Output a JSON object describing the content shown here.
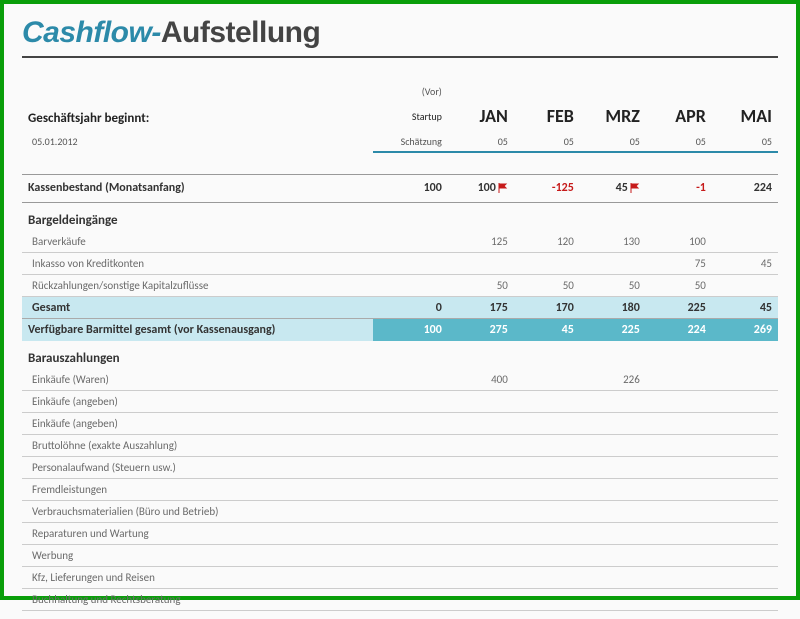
{
  "title": {
    "part1": "Cashflow-",
    "part2": "Aufstellung"
  },
  "fy_label": "Geschäftsjahr beginnt:",
  "fy_date": "05.01.2012",
  "pre_header": {
    "line1": "(Vor)",
    "line2": "Startup",
    "line3": "Schätzung"
  },
  "months": [
    "JAN",
    "FEB",
    "MRZ",
    "APR",
    "MAI"
  ],
  "year_suffix": [
    "05",
    "05",
    "05",
    "05",
    "05"
  ],
  "kassenbestand": {
    "label": "Kassenbestand (Monatsanfang)",
    "start": "100",
    "vals": [
      "100",
      "-125",
      "45",
      "-1",
      "224"
    ],
    "flags": [
      true,
      false,
      true,
      false,
      false
    ]
  },
  "eingaenge": {
    "title": "Bargeldeingänge",
    "rows": [
      {
        "label": "Barverkäufe",
        "start": "",
        "vals": [
          "125",
          "120",
          "130",
          "100",
          ""
        ]
      },
      {
        "label": "Inkasso von Kreditkonten",
        "start": "",
        "vals": [
          "",
          "",
          "",
          "75",
          "45"
        ]
      },
      {
        "label": "Rückzahlungen/sonstige Kapitalzuflüsse",
        "start": "",
        "vals": [
          "50",
          "50",
          "50",
          "50",
          ""
        ]
      }
    ],
    "gesamt": {
      "label": "Gesamt",
      "start": "0",
      "vals": [
        "175",
        "170",
        "180",
        "225",
        "45"
      ]
    },
    "verfuegbar": {
      "label": "Verfügbare Barmittel gesamt (vor Kassenausgang)",
      "start": "100",
      "vals": [
        "275",
        "45",
        "225",
        "224",
        "269"
      ]
    }
  },
  "auszahlungen": {
    "title": "Barauszahlungen",
    "rows": [
      {
        "label": "Einkäufe (Waren)",
        "start": "",
        "vals": [
          "400",
          "",
          "226",
          "",
          ""
        ]
      },
      {
        "label": "Einkäufe (angeben)",
        "start": "",
        "vals": [
          "",
          "",
          "",
          "",
          ""
        ]
      },
      {
        "label": "Einkäufe (angeben)",
        "start": "",
        "vals": [
          "",
          "",
          "",
          "",
          ""
        ]
      },
      {
        "label": "Bruttolöhne (exakte Auszahlung)",
        "start": "",
        "vals": [
          "",
          "",
          "",
          "",
          ""
        ]
      },
      {
        "label": "Personalaufwand (Steuern usw.)",
        "start": "",
        "vals": [
          "",
          "",
          "",
          "",
          ""
        ]
      },
      {
        "label": "Fremdleistungen",
        "start": "",
        "vals": [
          "",
          "",
          "",
          "",
          ""
        ]
      },
      {
        "label": "Verbrauchsmaterialien (Büro und Betrieb)",
        "start": "",
        "vals": [
          "",
          "",
          "",
          "",
          ""
        ]
      },
      {
        "label": "Reparaturen und Wartung",
        "start": "",
        "vals": [
          "",
          "",
          "",
          "",
          ""
        ]
      },
      {
        "label": "Werbung",
        "start": "",
        "vals": [
          "",
          "",
          "",
          "",
          ""
        ]
      },
      {
        "label": "Kfz, Lieferungen und Reisen",
        "start": "",
        "vals": [
          "",
          "",
          "",
          "",
          ""
        ]
      },
      {
        "label": "Buchhaltung und Rechtsberatung",
        "start": "",
        "vals": [
          "",
          "",
          "",
          "",
          ""
        ]
      }
    ]
  },
  "chart_data": {
    "type": "table",
    "title": "Cashflow-Aufstellung",
    "columns": [
      "(Vor) Startup Schätzung",
      "JAN 05",
      "FEB 05",
      "MRZ 05",
      "APR 05",
      "MAI 05"
    ],
    "rows": [
      {
        "label": "Kassenbestand (Monatsanfang)",
        "values": [
          100,
          100,
          -125,
          45,
          -1,
          224
        ]
      },
      {
        "label": "Barverkäufe",
        "values": [
          null,
          125,
          120,
          130,
          100,
          null
        ]
      },
      {
        "label": "Inkasso von Kreditkonten",
        "values": [
          null,
          null,
          null,
          null,
          75,
          45
        ]
      },
      {
        "label": "Rückzahlungen/sonstige Kapitalzuflüsse",
        "values": [
          null,
          50,
          50,
          50,
          50,
          null
        ]
      },
      {
        "label": "Gesamt Bargeldeingänge",
        "values": [
          0,
          175,
          170,
          180,
          225,
          45
        ]
      },
      {
        "label": "Verfügbare Barmittel gesamt (vor Kassenausgang)",
        "values": [
          100,
          275,
          45,
          225,
          224,
          269
        ]
      },
      {
        "label": "Einkäufe (Waren)",
        "values": [
          null,
          400,
          null,
          226,
          null,
          null
        ]
      }
    ]
  }
}
